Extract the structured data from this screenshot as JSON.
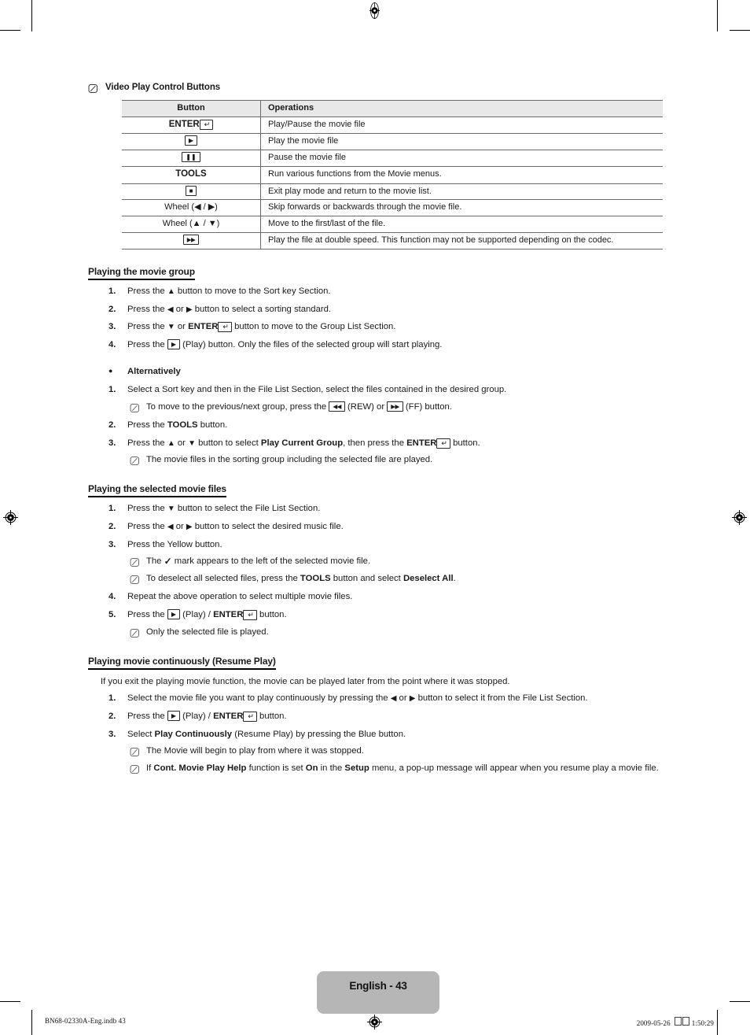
{
  "note_title": "Video Play Control Buttons",
  "table": {
    "headers": [
      "Button",
      "Operations"
    ],
    "rows": [
      {
        "button": "ENTER",
        "button_key": "return-arrow",
        "button_bold": true,
        "operation": "Play/Pause the movie file"
      },
      {
        "button": "",
        "button_key": "play",
        "button_bold": false,
        "operation": "Play the movie file"
      },
      {
        "button": "",
        "button_key": "pause",
        "button_bold": false,
        "operation": "Pause the movie file"
      },
      {
        "button": "TOOLS",
        "button_key": "",
        "button_bold": true,
        "operation": "Run various functions from the Movie menus."
      },
      {
        "button": "",
        "button_key": "stop",
        "button_bold": false,
        "operation": "Exit play mode and return to the movie list."
      },
      {
        "button": "Wheel (◀ / ▶)",
        "button_key": "",
        "button_bold": false,
        "operation": "Skip forwards or backwards through the movie file."
      },
      {
        "button": "Wheel (▲ / ▼)",
        "button_key": "",
        "button_bold": false,
        "operation": "Move to the first/last of the file."
      },
      {
        "button": "",
        "button_key": "fast-forward",
        "button_bold": false,
        "operation": "Play the file at double speed. This function may not be supported depending on the codec."
      }
    ]
  },
  "sections": [
    {
      "heading": "Playing the movie group",
      "steps": [
        {
          "marker": "1.",
          "text": "Press the ▲ button to move to the Sort key Section."
        },
        {
          "marker": "2.",
          "text": "Press the ◀ or ▶ button to select a sorting standard."
        },
        {
          "marker": "3.",
          "text": "Press the ▼ or ENTER⏎ button to move to the Group List Section."
        },
        {
          "marker": "4.",
          "text": "Press the ▶ (Play) button. Only the files of the selected group will start playing."
        },
        {
          "marker": "●",
          "text": "Alternatively"
        },
        {
          "marker": "1.",
          "text": "Select a Sort key and then in the File List Section, select the files contained in the desired group."
        },
        {
          "marker": "",
          "text": "To move to the previous/next group, press the ◀◀ (REW) or ▶▶ (FF) button."
        },
        {
          "marker": "2.",
          "text": "Press the TOOLS button."
        },
        {
          "marker": "3.",
          "text": "Press the ▲ or ▼ button to select Play Current Group, then press the ENTER⏎ button."
        },
        {
          "marker": "",
          "text": "The movie files in the sorting group including the selected file are played."
        }
      ]
    },
    {
      "heading": "Playing the selected movie files",
      "steps": [
        {
          "marker": "1.",
          "text": "Press the ▼ button to select the File List Section."
        },
        {
          "marker": "2.",
          "text": "Press the ◀ or ▶ button to select the desired music file."
        },
        {
          "marker": "3.",
          "text": "Press the Yellow button."
        },
        {
          "marker": "",
          "text": "The ✓ mark appears to the left of the selected movie file."
        },
        {
          "marker": "",
          "text": "To deselect all selected files, press the TOOLS button and select Deselect All."
        },
        {
          "marker": "4.",
          "text": "Repeat the above operation to select multiple movie files."
        },
        {
          "marker": "5.",
          "text": "Press the ▶ (Play) / ENTER⏎ button."
        },
        {
          "marker": "",
          "text": "Only the selected file is played."
        }
      ]
    },
    {
      "heading": "Playing movie continuously (Resume Play)",
      "intro": "If you exit the playing movie function, the movie can be played later from the point where it was stopped.",
      "steps": [
        {
          "marker": "1.",
          "text": "Select the movie file you want to play continuously by pressing the ◀ or ▶ button to select it from the File List Section."
        },
        {
          "marker": "2.",
          "text": "Press the ▶ (Play) / ENTER⏎ button."
        },
        {
          "marker": "3.",
          "text": "Select Play Continuously (Resume Play) by pressing the Blue button."
        },
        {
          "marker": "",
          "text": "The Movie will begin to play from where it was stopped."
        },
        {
          "marker": "",
          "text": "If Cont. Movie Play Help function is set On in the Setup menu, a pop-up message will appear when you resume play a movie file."
        }
      ]
    }
  ],
  "footer": {
    "page_badge": "English - 43",
    "file_ref": "BN68-02330A-Eng.indb   43",
    "date": "2009-05-26",
    "time": "1:50:29"
  },
  "colors": {
    "table_header_bg": "#e8e8e8",
    "table_border": "#6a6a6a",
    "badge_bg": "#b6b6b6",
    "text": "#1a1a1a"
  }
}
